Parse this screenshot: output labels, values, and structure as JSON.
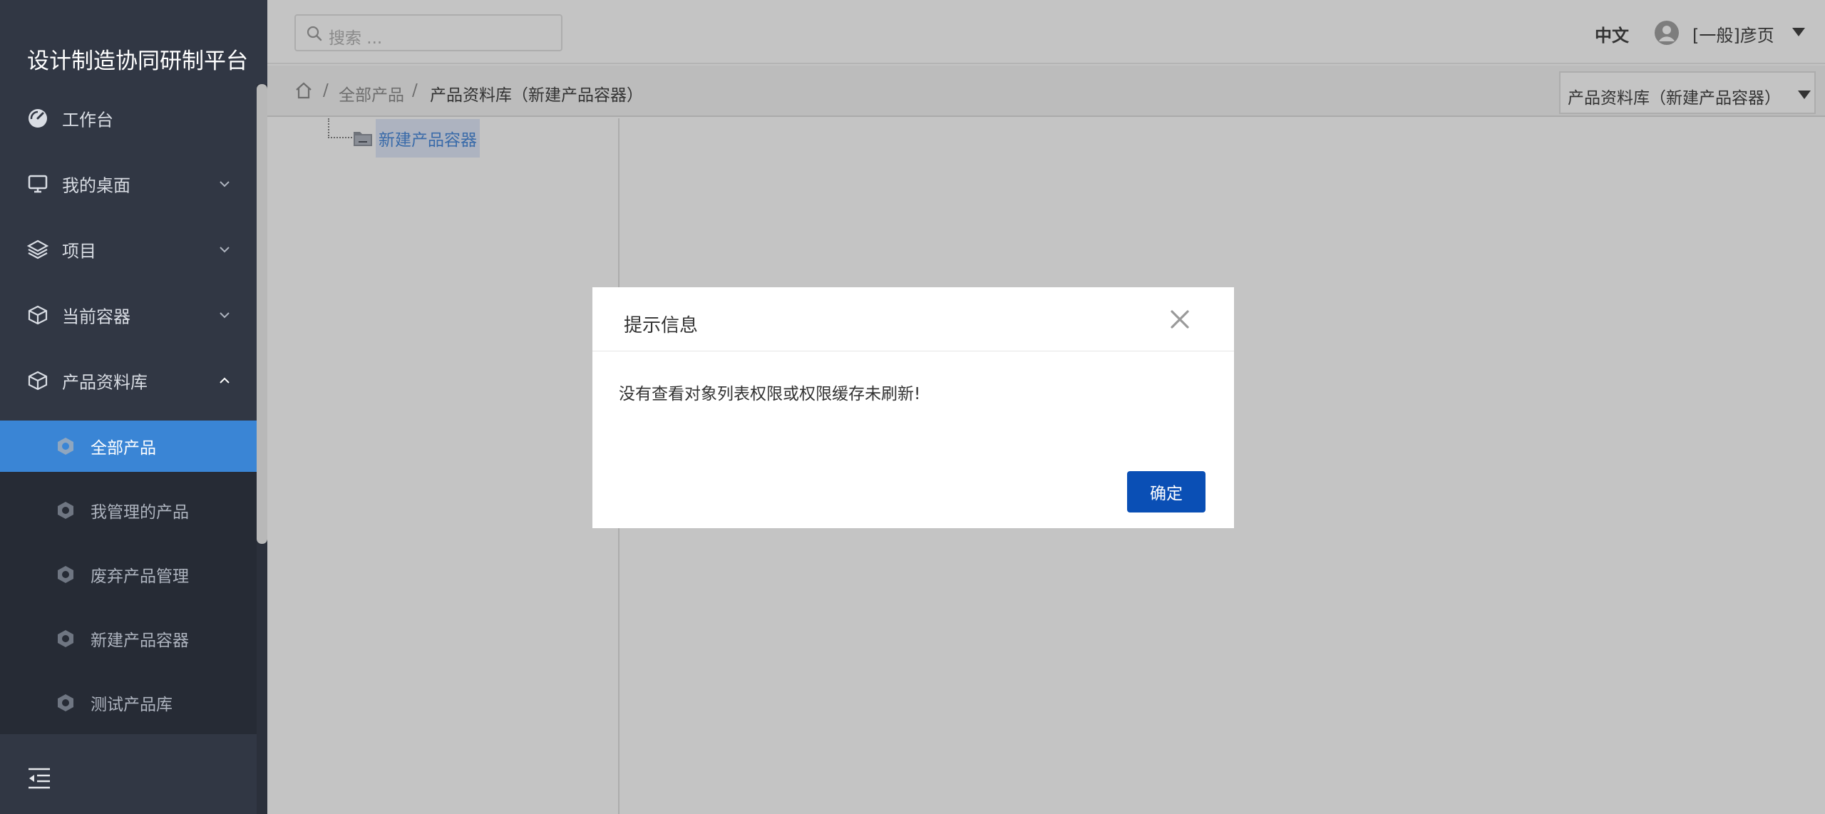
{
  "app": {
    "title": "设计制造协同研制平台"
  },
  "sidebar": {
    "items": [
      {
        "label": "工作台",
        "icon": "dashboard-icon",
        "chevron": ""
      },
      {
        "label": "我的桌面",
        "icon": "monitor-icon",
        "chevron": "down"
      },
      {
        "label": "项目",
        "icon": "layers-icon",
        "chevron": "down"
      },
      {
        "label": "当前容器",
        "icon": "container-icon",
        "chevron": "down"
      },
      {
        "label": "产品资料库",
        "icon": "cube-icon",
        "chevron": "up"
      }
    ],
    "subitems": [
      {
        "label": "全部产品",
        "active": true
      },
      {
        "label": "我管理的产品",
        "active": false
      },
      {
        "label": "废弃产品管理",
        "active": false
      },
      {
        "label": "新建产品容器",
        "active": false
      },
      {
        "label": "测试产品库",
        "active": false
      }
    ],
    "collapse_icon": "menu-collapse-icon"
  },
  "header": {
    "search_placeholder": "搜索 ...",
    "language": "中文",
    "username": "[一般]彦页"
  },
  "breadcrumb": {
    "items": [
      "全部产品",
      "产品资料库（新建产品容器）"
    ],
    "separator": "/",
    "context_select": "产品资料库（新建产品容器）"
  },
  "tree": {
    "node_label": "新建产品容器"
  },
  "dialog": {
    "title": "提示信息",
    "message": "没有查看对象列表权限或权限缓存未刷新!",
    "ok_label": "确定"
  },
  "colors": {
    "sidebar_bg": "#313744",
    "submenu_bg": "#262b35",
    "active_item": "#3a85d5",
    "primary_button": "#0a4fb5",
    "overlay": "#c4c4c4"
  }
}
